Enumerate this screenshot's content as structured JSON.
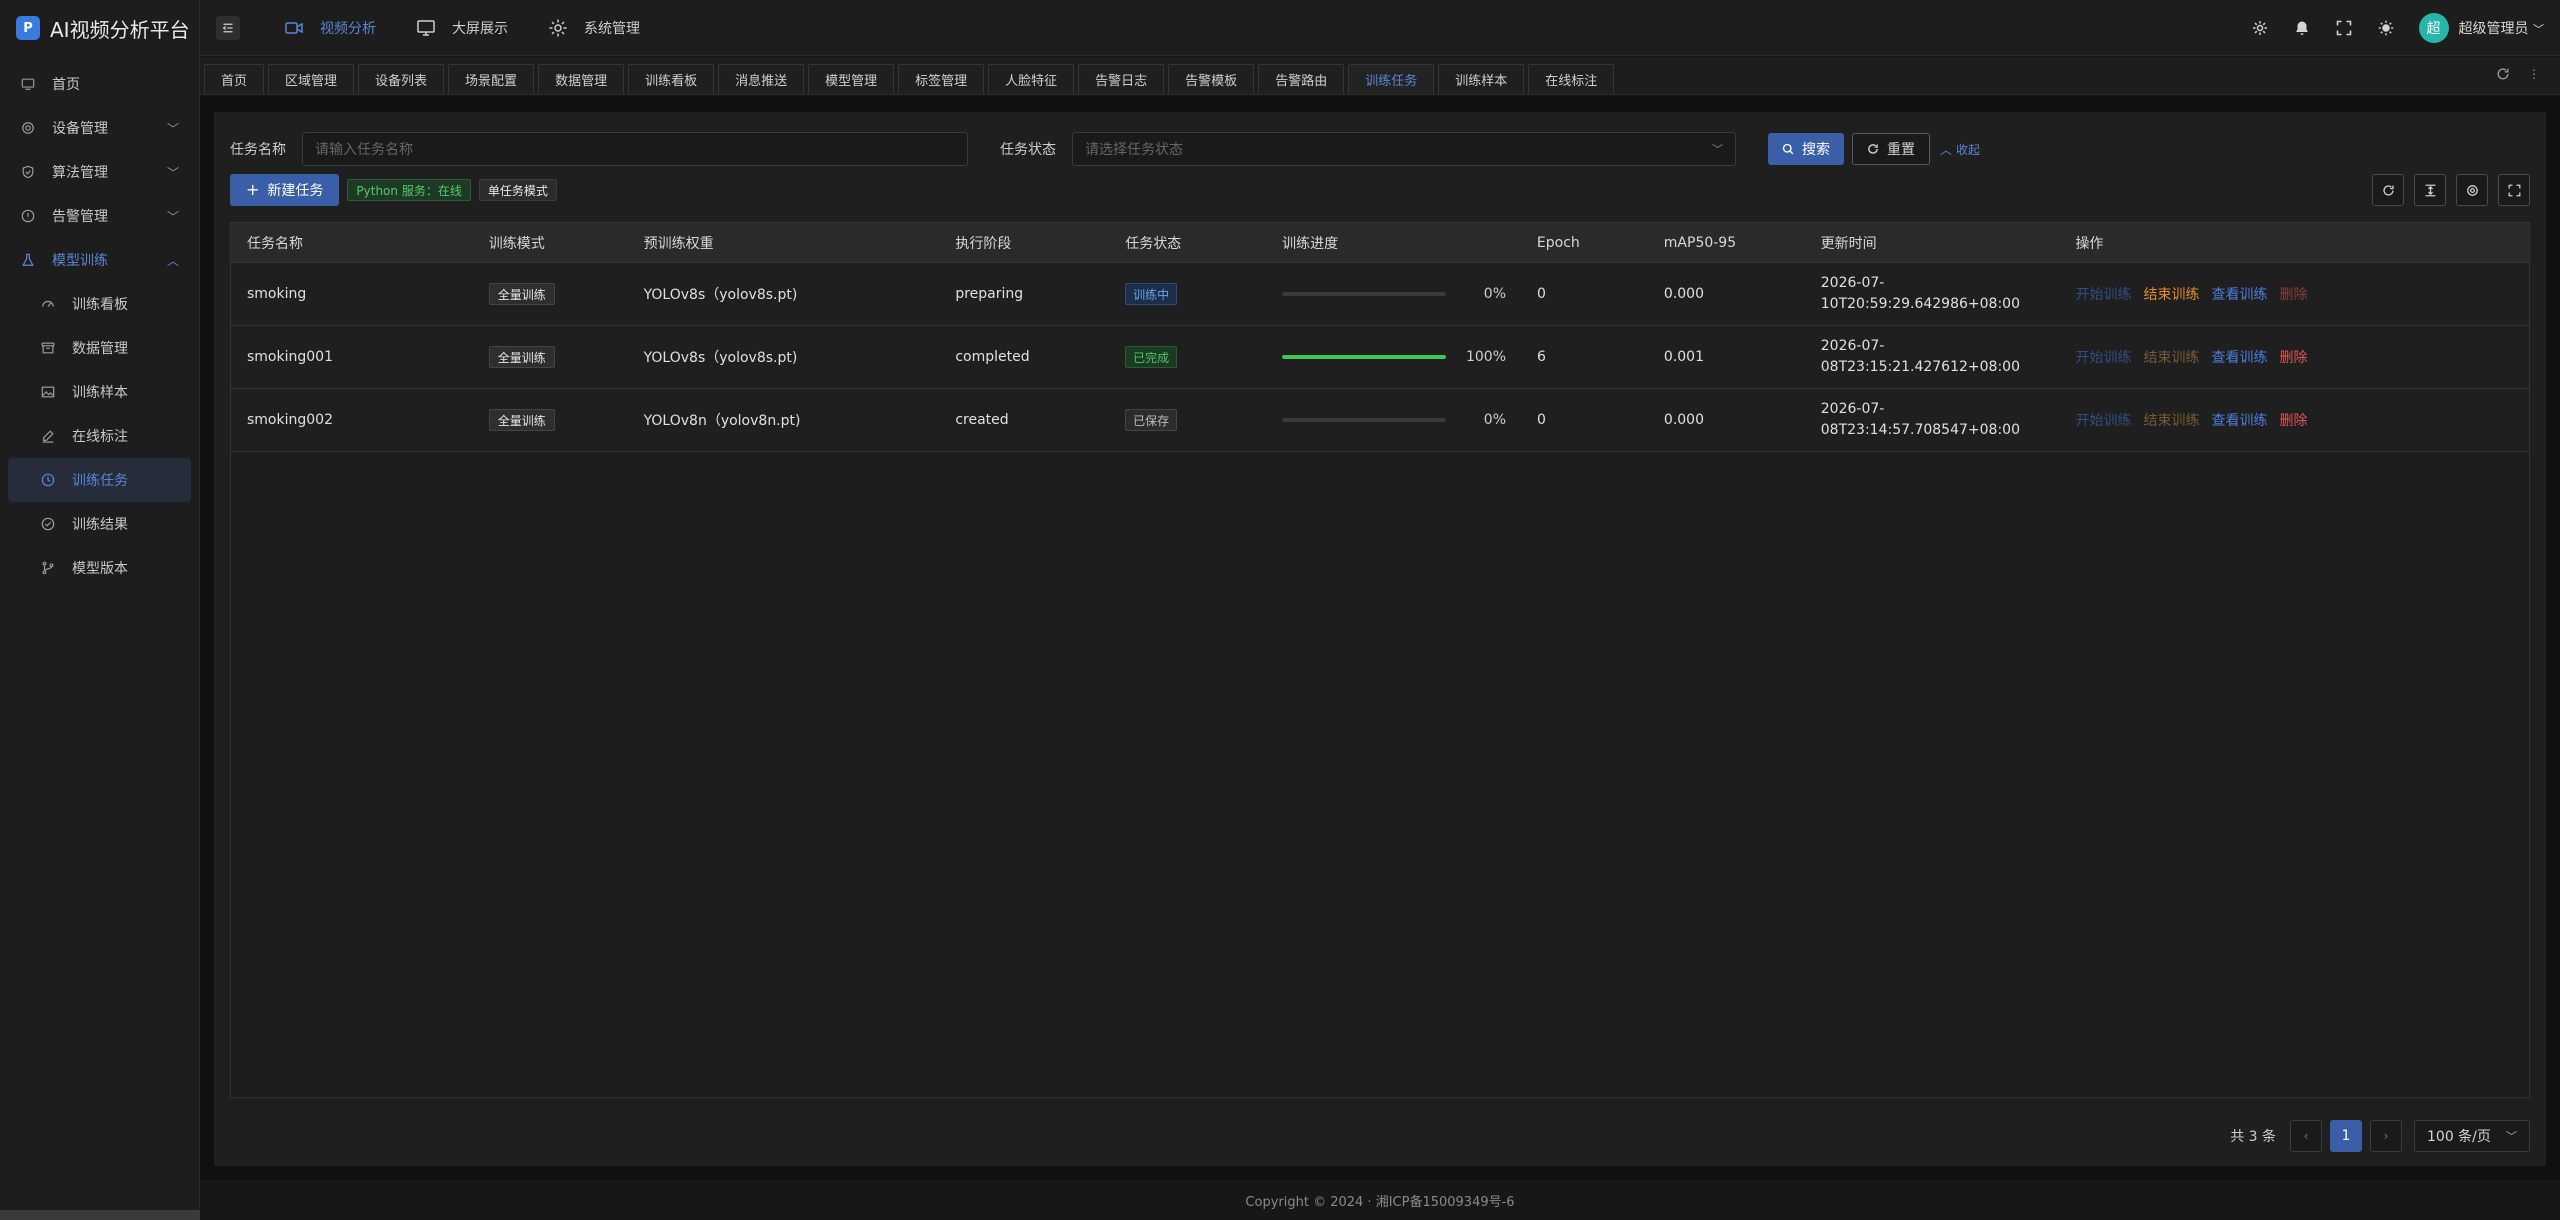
{
  "app": {
    "title": "AI视频分析平台",
    "logo_letter": "P"
  },
  "sidebar": {
    "items": [
      {
        "label": "首页",
        "icon": "monitor-icon"
      },
      {
        "label": "设备管理",
        "icon": "gear-icon"
      },
      {
        "label": "算法管理",
        "icon": "shield-icon"
      },
      {
        "label": "告警管理",
        "icon": "alert-icon"
      },
      {
        "label": "模型训练",
        "icon": "flask-icon"
      }
    ],
    "subitems": [
      {
        "label": "训练看板"
      },
      {
        "label": "数据管理"
      },
      {
        "label": "训练样本"
      },
      {
        "label": "在线标注"
      },
      {
        "label": "训练任务"
      },
      {
        "label": "训练结果"
      },
      {
        "label": "模型版本"
      }
    ]
  },
  "header": {
    "nav": [
      {
        "label": "视频分析"
      },
      {
        "label": "大屏展示"
      },
      {
        "label": "系统管理"
      }
    ],
    "avatar_text": "超",
    "user_name": "超级管理员"
  },
  "tabs": [
    "首页",
    "区域管理",
    "设备列表",
    "场景配置",
    "数据管理",
    "训练看板",
    "消息推送",
    "模型管理",
    "标签管理",
    "人脸特征",
    "告警日志",
    "告警模板",
    "告警路由",
    "训练任务",
    "训练样本",
    "在线标注"
  ],
  "search": {
    "name_label": "任务名称",
    "name_placeholder": "请输入任务名称",
    "status_label": "任务状态",
    "status_placeholder": "请选择任务状态",
    "search_btn": "搜索",
    "reset_btn": "重置",
    "collapse": "收起"
  },
  "toolbar": {
    "new_task": "新建任务",
    "python_tag": "Python 服务：在线",
    "mode_tag": "单任务模式"
  },
  "table": {
    "headers": [
      "任务名称",
      "训练模式",
      "预训练权重",
      "执行阶段",
      "任务状态",
      "训练进度",
      "Epoch",
      "mAP50-95",
      "更新时间",
      "操作"
    ],
    "rows": [
      {
        "name": "smoking",
        "mode": "全量训练",
        "weight": "YOLOv8s（yolov8s.pt)",
        "stage": "preparing",
        "status": "训练中",
        "status_type": "blue",
        "progress": 0,
        "progress_text": "0%",
        "epoch": "0",
        "map": "0.000",
        "time": "2026-07-10T20:59:29.642986+08:00"
      },
      {
        "name": "smoking001",
        "mode": "全量训练",
        "weight": "YOLOv8s（yolov8s.pt)",
        "stage": "completed",
        "status": "已完成",
        "status_type": "green",
        "progress": 100,
        "progress_text": "100%",
        "epoch": "6",
        "map": "0.001",
        "time": "2026-07-08T23:15:21.427612+08:00"
      },
      {
        "name": "smoking002",
        "mode": "全量训练",
        "weight": "YOLOv8n（yolov8n.pt)",
        "stage": "created",
        "status": "已保存",
        "status_type": "grey",
        "progress": 0,
        "progress_text": "0%",
        "epoch": "0",
        "map": "0.000",
        "time": "2026-07-08T23:14:57.708547+08:00"
      }
    ],
    "actions": {
      "start": "开始训练",
      "stop": "结束训练",
      "view": "查看训练",
      "delete": "删除"
    }
  },
  "pagination": {
    "total": "共 3 条",
    "current": "1",
    "page_size": "100 条/页"
  },
  "footer": "Copyright © 2024 · 湘ICP备15009349号-6",
  "colors": {
    "accent": "#5a86d6",
    "primary": "#3a5fa8",
    "success": "#41c853",
    "danger": "#e05555",
    "warning": "#e88b2b"
  }
}
